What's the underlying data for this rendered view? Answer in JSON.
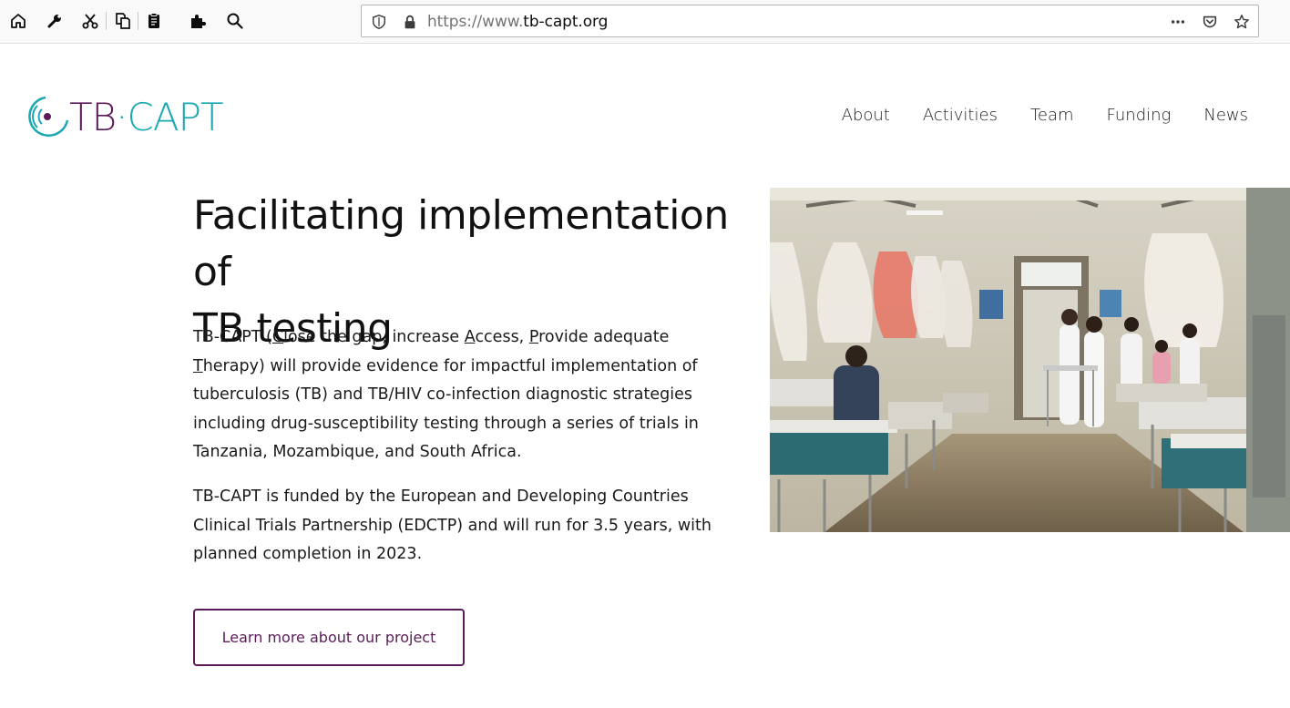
{
  "browser": {
    "url_prefix": "https://www.",
    "url_domain": "tb-capt.org",
    "toolbar_icons": [
      "home-icon",
      "wrench-icon",
      "scissors-icon",
      "copy-icon",
      "clipboard-icon",
      "puzzle-icon",
      "search-icon"
    ],
    "url_icons": [
      "shield-icon",
      "lock-icon"
    ],
    "right_icons": [
      "more-icon",
      "pocket-icon",
      "star-icon"
    ]
  },
  "site": {
    "logo": {
      "tb": "TB",
      "dot": "·",
      "capt": "CAPT"
    },
    "nav": [
      "About",
      "Activities",
      "Team",
      "Funding",
      "News"
    ]
  },
  "hero": {
    "title_line1": "Facilitating implementation of",
    "title_line2": "TB testing",
    "p1": {
      "a": "TB-CAPT (",
      "c": "C",
      "b": "lose the gap, increase ",
      "acc": "A",
      "d": "ccess, ",
      "p": "P",
      "e": "rovide adequate ",
      "t": "T",
      "f": "herapy) will provide evidence for impactful implementation of tuberculosis (TB) and TB/HIV co-infection diagnostic strategies including drug-susceptibility testing through a series of trials in Tanzania, Mozambique, and South Africa."
    },
    "p2": "TB-CAPT is funded by the European and Developing Countries Clinical Trials Partnership (EDCTP) and will run for 3.5 years, with planned completion in 2023.",
    "cta": "Learn more about our project"
  },
  "colors": {
    "brand_purple": "#5b1b5a",
    "brand_teal": "#1aa9b2"
  }
}
